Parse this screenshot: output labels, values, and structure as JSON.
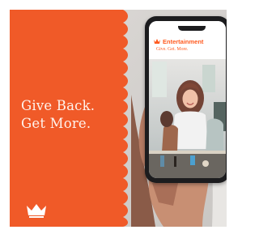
{
  "ad": {
    "headline_line1": "Give Back.",
    "headline_line2": "Get More.",
    "logo_icon": "crown-icon"
  },
  "phone_screen": {
    "brand_name": "Entertainment",
    "brand_icon": "crown-icon",
    "tagline": "Give. Get. More."
  },
  "colors": {
    "brand_orange": "#f05a28",
    "panel_text": "#fff3ec",
    "phone_frame": "#1c1c1e"
  }
}
